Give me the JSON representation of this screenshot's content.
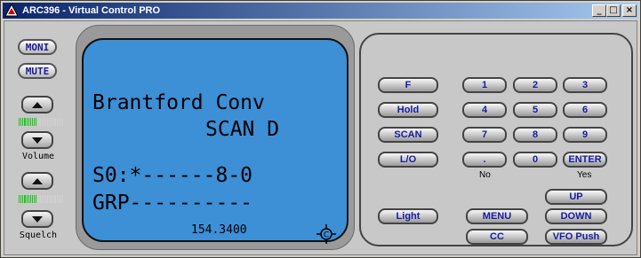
{
  "window": {
    "title": "ARC396 - Virtual Control PRO",
    "minimize_label": "_",
    "maximize_label": "□",
    "close_label": "×"
  },
  "left_controls": {
    "moni_label": "MONI",
    "mute_label": "MUTE",
    "volume_label": "Volume",
    "volume_level": 0.42,
    "squelch_label": "Squelch",
    "squelch_level": 0.42
  },
  "lcd": {
    "line1": "Brantford Conv",
    "line2": "SCAN D",
    "line3": "S0:*------8-0",
    "line4": "GRP----------",
    "frequency": "154.3400",
    "indicator_icon": "ctcss-target-icon",
    "background_color": "#3d8fd6"
  },
  "keypad": {
    "f_label": "F",
    "hold_label": "Hold",
    "scan_label": "SCAN",
    "lo_label": "L/O",
    "light_label": "Light",
    "digits": [
      "1",
      "2",
      "3",
      "4",
      "5",
      "6",
      "7",
      "8",
      "9"
    ],
    "dot_label": ".",
    "zero_label": "0",
    "enter_label": "ENTER",
    "no_label": "No",
    "yes_label": "Yes",
    "up_label": "UP",
    "down_label": "DOWN",
    "menu_label": "MENU",
    "cc_label": "CC",
    "vfo_push_label": "VFO Push"
  }
}
